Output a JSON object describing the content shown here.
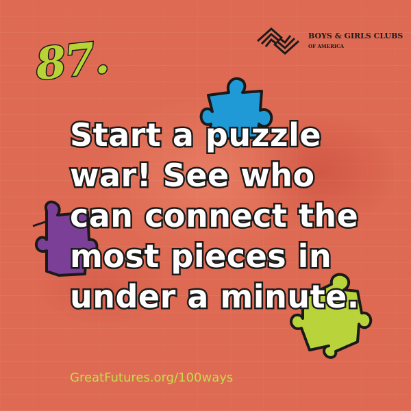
{
  "tip_number": "87.",
  "logo": {
    "line1": "BOYS & GIRLS CLUBS",
    "line2": "OF AMERICA"
  },
  "message_lines": [
    "Start a puzzle",
    "war! See who",
    "can connect the",
    "most pieces in",
    "under a minute."
  ],
  "footer_url": "GreatFutures.org/100ways",
  "colors": {
    "background": "#de6a53",
    "number": "#b7d336",
    "url": "#c5dd4a",
    "piece_blue": "#1f9ad6",
    "piece_purple": "#7b3f98",
    "piece_green": "#b9d33a"
  },
  "decorations": [
    "blue-puzzle-piece",
    "purple-puzzle-piece",
    "green-puzzle-piece"
  ]
}
